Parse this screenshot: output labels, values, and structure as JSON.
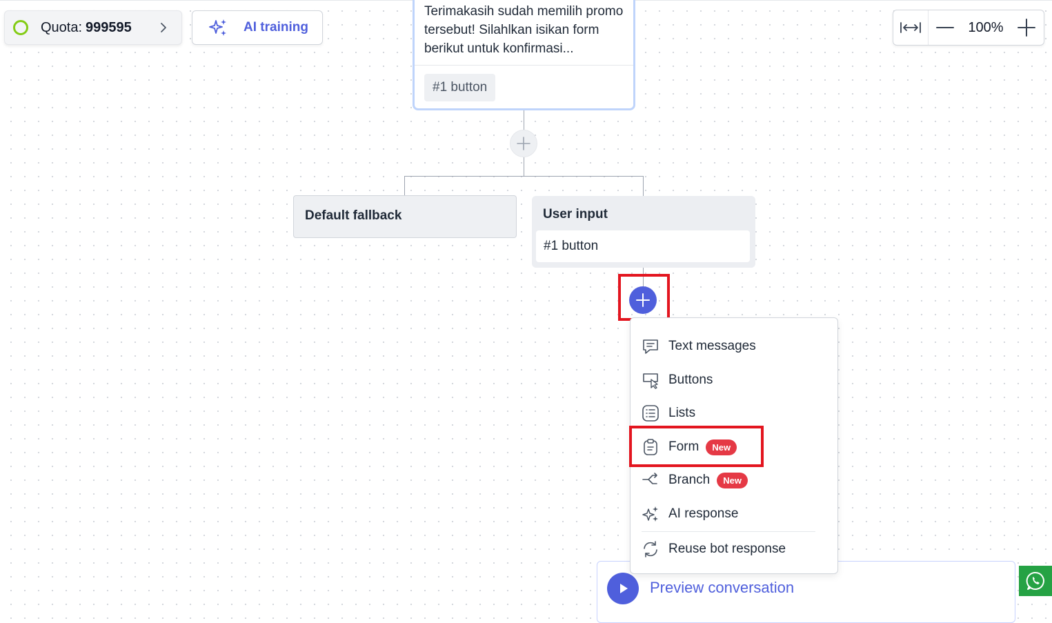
{
  "toolbar": {
    "quota_label": "Quota:",
    "quota_value": "999595",
    "ai_training_label": "AI training",
    "zoom_level": "100%"
  },
  "flow": {
    "message_text": "Terimakasih sudah memilih promo tersebut! Silahlkan isikan form berikut untuk konfirmasi...",
    "message_button": "#1 button",
    "fallback_title": "Default fallback",
    "user_input_title": "User input",
    "user_input_value": "#1 button"
  },
  "menu": {
    "items": [
      {
        "label": "Text messages",
        "icon": "chat-icon"
      },
      {
        "label": "Buttons",
        "icon": "button-icon"
      },
      {
        "label": "Lists",
        "icon": "list-icon"
      },
      {
        "label": "Form",
        "icon": "clipboard-icon",
        "badge": "New"
      },
      {
        "label": "Branch",
        "icon": "branch-icon",
        "badge": "New"
      },
      {
        "label": "AI response",
        "icon": "sparkle-icon"
      },
      {
        "label": "Reuse bot response",
        "icon": "refresh-icon"
      }
    ]
  },
  "preview": {
    "label": "Preview conversation"
  },
  "colors": {
    "accent": "#4f5fdc",
    "badge": "#e53945",
    "highlight": "#e3151f",
    "quota_ring": "#84cc16",
    "whatsapp": "#25a244"
  }
}
